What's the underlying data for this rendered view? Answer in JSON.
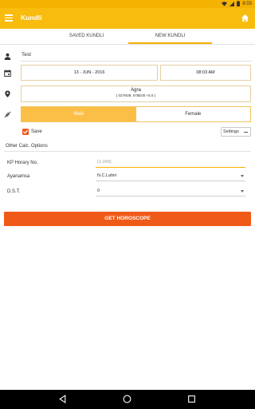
{
  "status_bar": {
    "time": "8:03"
  },
  "app_bar": {
    "title": "Kundli"
  },
  "tabs": [
    {
      "label": "SAVED KUNDLI",
      "active": false
    },
    {
      "label": "NEW KUNDLI",
      "active": true
    }
  ],
  "form": {
    "name_value": "Test",
    "date_value": "13 - JUN - 2016",
    "time_value": "08:03 AM",
    "place_name": "Agra",
    "place_coords": "( 027N09, 078E00 +5.5 )",
    "gender_options": [
      "Male",
      "Female"
    ],
    "gender_selected": "Male",
    "save_label": "Save",
    "save_checked": true,
    "settings_label": "Settings"
  },
  "other_options": {
    "title": "Other Calc. Options",
    "kp_label": "KP Horary No.",
    "kp_placeholder": "(1-249)",
    "ayanamsa_label": "Ayanamsa",
    "ayanamsa_value": "N.C.Lahiri",
    "dst_label": "D.S.T.",
    "dst_value": "0"
  },
  "cta_label": "GET HOROSCOPE",
  "colors": {
    "accent": "#f8bc0f",
    "cta": "#f05a18",
    "male_selected": "#fbbf48"
  },
  "icons": [
    "menu-icon",
    "home-icon",
    "person-icon",
    "calendar-icon",
    "location-pin-icon",
    "compass-icon",
    "check-icon",
    "back-icon",
    "home-circle-icon",
    "recents-icon"
  ]
}
